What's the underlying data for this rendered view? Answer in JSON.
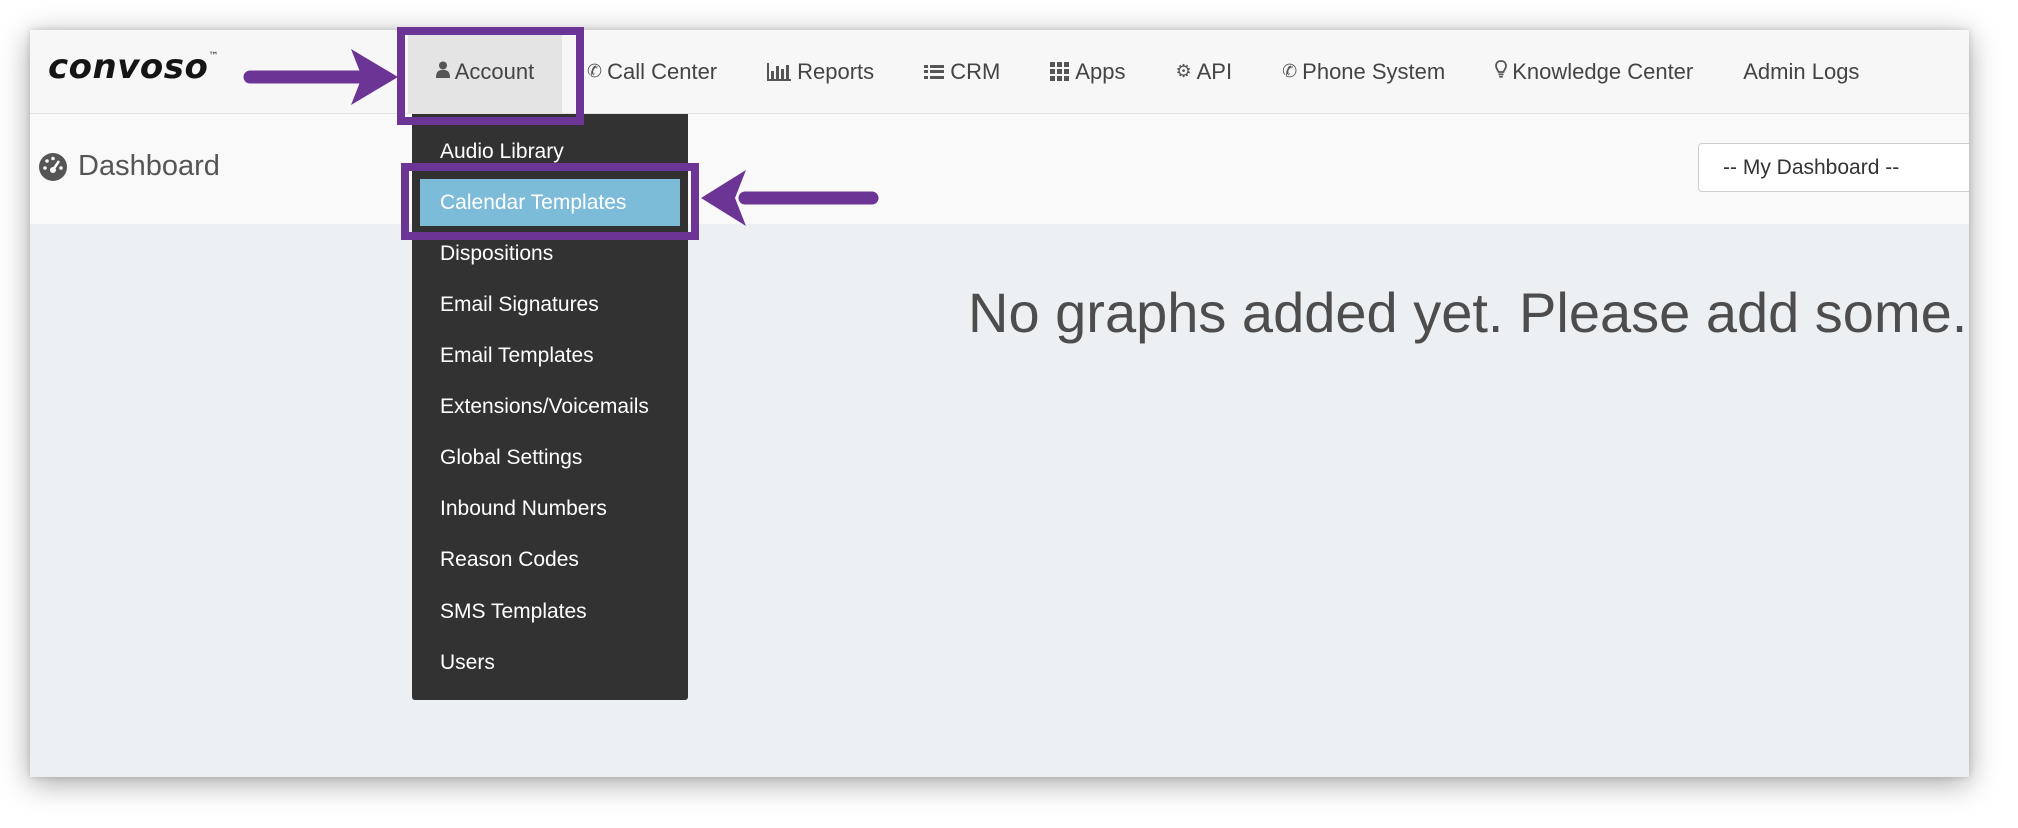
{
  "brand": {
    "logo_text": "convoso",
    "logo_mark": "™"
  },
  "nav": {
    "items": [
      {
        "label": "Account",
        "icon": "user-icon"
      },
      {
        "label": "Call Center",
        "icon": "phone-icon"
      },
      {
        "label": "Reports",
        "icon": "bar-chart-icon"
      },
      {
        "label": "CRM",
        "icon": "list-icon"
      },
      {
        "label": "Apps",
        "icon": "grid-icon"
      },
      {
        "label": "API",
        "icon": "gear-icon"
      },
      {
        "label": "Phone System",
        "icon": "phone-icon"
      },
      {
        "label": "Knowledge Center",
        "icon": "lightbulb-icon"
      },
      {
        "label": "Admin Logs",
        "icon": ""
      }
    ],
    "active": "Account"
  },
  "header": {
    "title": "Dashboard",
    "title_icon": "dashboard-gauge-icon",
    "dashboard_select_value": "-- My Dashboard --"
  },
  "main": {
    "empty_message": "No graphs added yet. Please add some."
  },
  "account_menu": {
    "items": [
      "Audio Library",
      "Calendar Templates",
      "Dispositions",
      "Email Signatures",
      "Email Templates",
      "Extensions/Voicemails",
      "Global Settings",
      "Inbound Numbers",
      "Reason Codes",
      "SMS Templates",
      "Users"
    ],
    "highlighted": "Calendar Templates"
  },
  "colors": {
    "annotation_purple": "#6c3595",
    "menu_background": "#323232",
    "menu_highlight": "#7dbcd8",
    "content_background": "#edf0f3"
  }
}
